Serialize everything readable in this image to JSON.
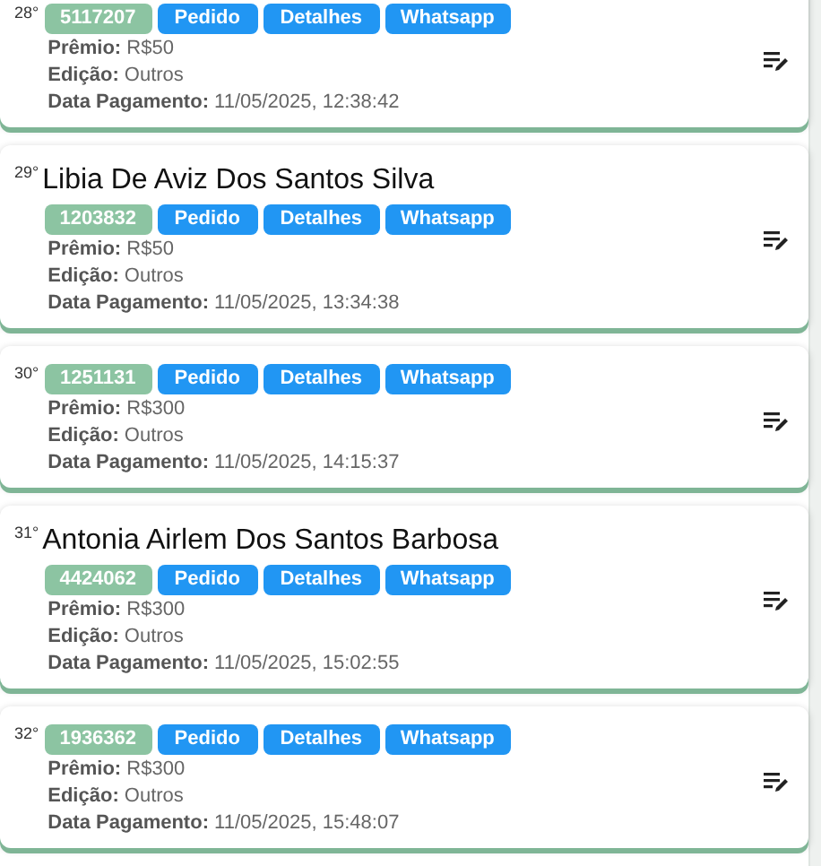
{
  "cards": [
    {
      "rank": "28°",
      "badge": "5117207",
      "buttons": [
        "Pedido",
        "Detalhes",
        "Whatsapp"
      ],
      "fields": [
        {
          "label": "Prêmio:",
          "value": "R$50"
        },
        {
          "label": "Edição:",
          "value": "Outros"
        },
        {
          "label": "Data Pagamento:",
          "value": "11/05/2025, 12:38:42"
        }
      ]
    },
    {
      "rank": "29°",
      "name": "Libia De Aviz Dos Santos Silva",
      "badge": "1203832",
      "buttons": [
        "Pedido",
        "Detalhes",
        "Whatsapp"
      ],
      "fields": [
        {
          "label": "Prêmio:",
          "value": "R$50"
        },
        {
          "label": "Edição:",
          "value": "Outros"
        },
        {
          "label": "Data Pagamento:",
          "value": "11/05/2025, 13:34:38"
        }
      ]
    },
    {
      "rank": "30°",
      "badge": "1251131",
      "buttons": [
        "Pedido",
        "Detalhes",
        "Whatsapp"
      ],
      "fields": [
        {
          "label": "Prêmio:",
          "value": "R$300"
        },
        {
          "label": "Edição:",
          "value": "Outros"
        },
        {
          "label": "Data Pagamento:",
          "value": "11/05/2025, 14:15:37"
        }
      ]
    },
    {
      "rank": "31°",
      "name": "Antonia Airlem Dos Santos Barbosa",
      "badge": "4424062",
      "buttons": [
        "Pedido",
        "Detalhes",
        "Whatsapp"
      ],
      "fields": [
        {
          "label": "Prêmio:",
          "value": "R$300"
        },
        {
          "label": "Edição:",
          "value": "Outros"
        },
        {
          "label": "Data Pagamento:",
          "value": "11/05/2025, 15:02:55"
        }
      ]
    },
    {
      "rank": "32°",
      "badge": "1936362",
      "buttons": [
        "Pedido",
        "Detalhes",
        "Whatsapp"
      ],
      "fields": [
        {
          "label": "Prêmio:",
          "value": "R$300"
        },
        {
          "label": "Edição:",
          "value": "Outros"
        },
        {
          "label": "Data Pagamento:",
          "value": "11/05/2025, 15:48:07"
        }
      ]
    }
  ]
}
